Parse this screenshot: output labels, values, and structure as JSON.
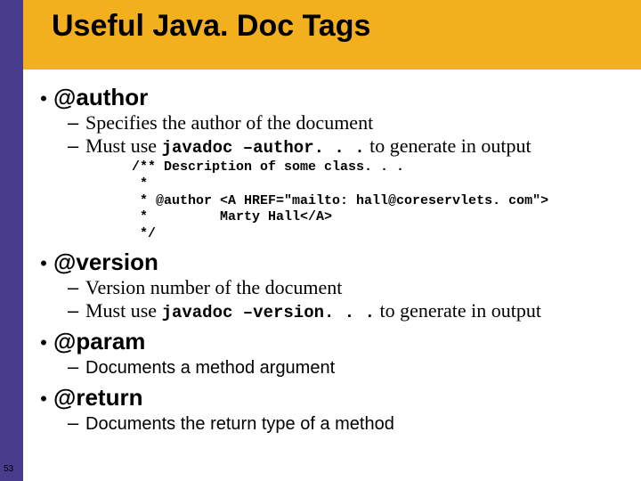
{
  "title": "Useful Java. Doc Tags",
  "items": [
    {
      "heading": "@author",
      "subs": [
        {
          "style": "serif",
          "html": "Specifies the author of the document"
        },
        {
          "style": "serif",
          "html": "Must use <span class='mono'>javadoc –author. . .</span> to generate in output"
        }
      ],
      "code": "/** Description of some class. . .\n *\n * @author <A HREF=\"mailto: hall@coreservlets. com\">\n *         Marty Hall</A>\n */"
    },
    {
      "heading": "@version",
      "subs": [
        {
          "style": "serif",
          "html": "Version number of the document"
        },
        {
          "style": "serif",
          "html": "Must use <span class='mono'>javadoc –version. . .</span> to generate in output"
        }
      ]
    },
    {
      "heading": "@param",
      "subs": [
        {
          "style": "arial",
          "html": "Documents a method argument"
        }
      ]
    },
    {
      "heading": "@return",
      "subs": [
        {
          "style": "arial",
          "html": "Documents the return type of a method"
        }
      ]
    }
  ],
  "page_number": "53"
}
